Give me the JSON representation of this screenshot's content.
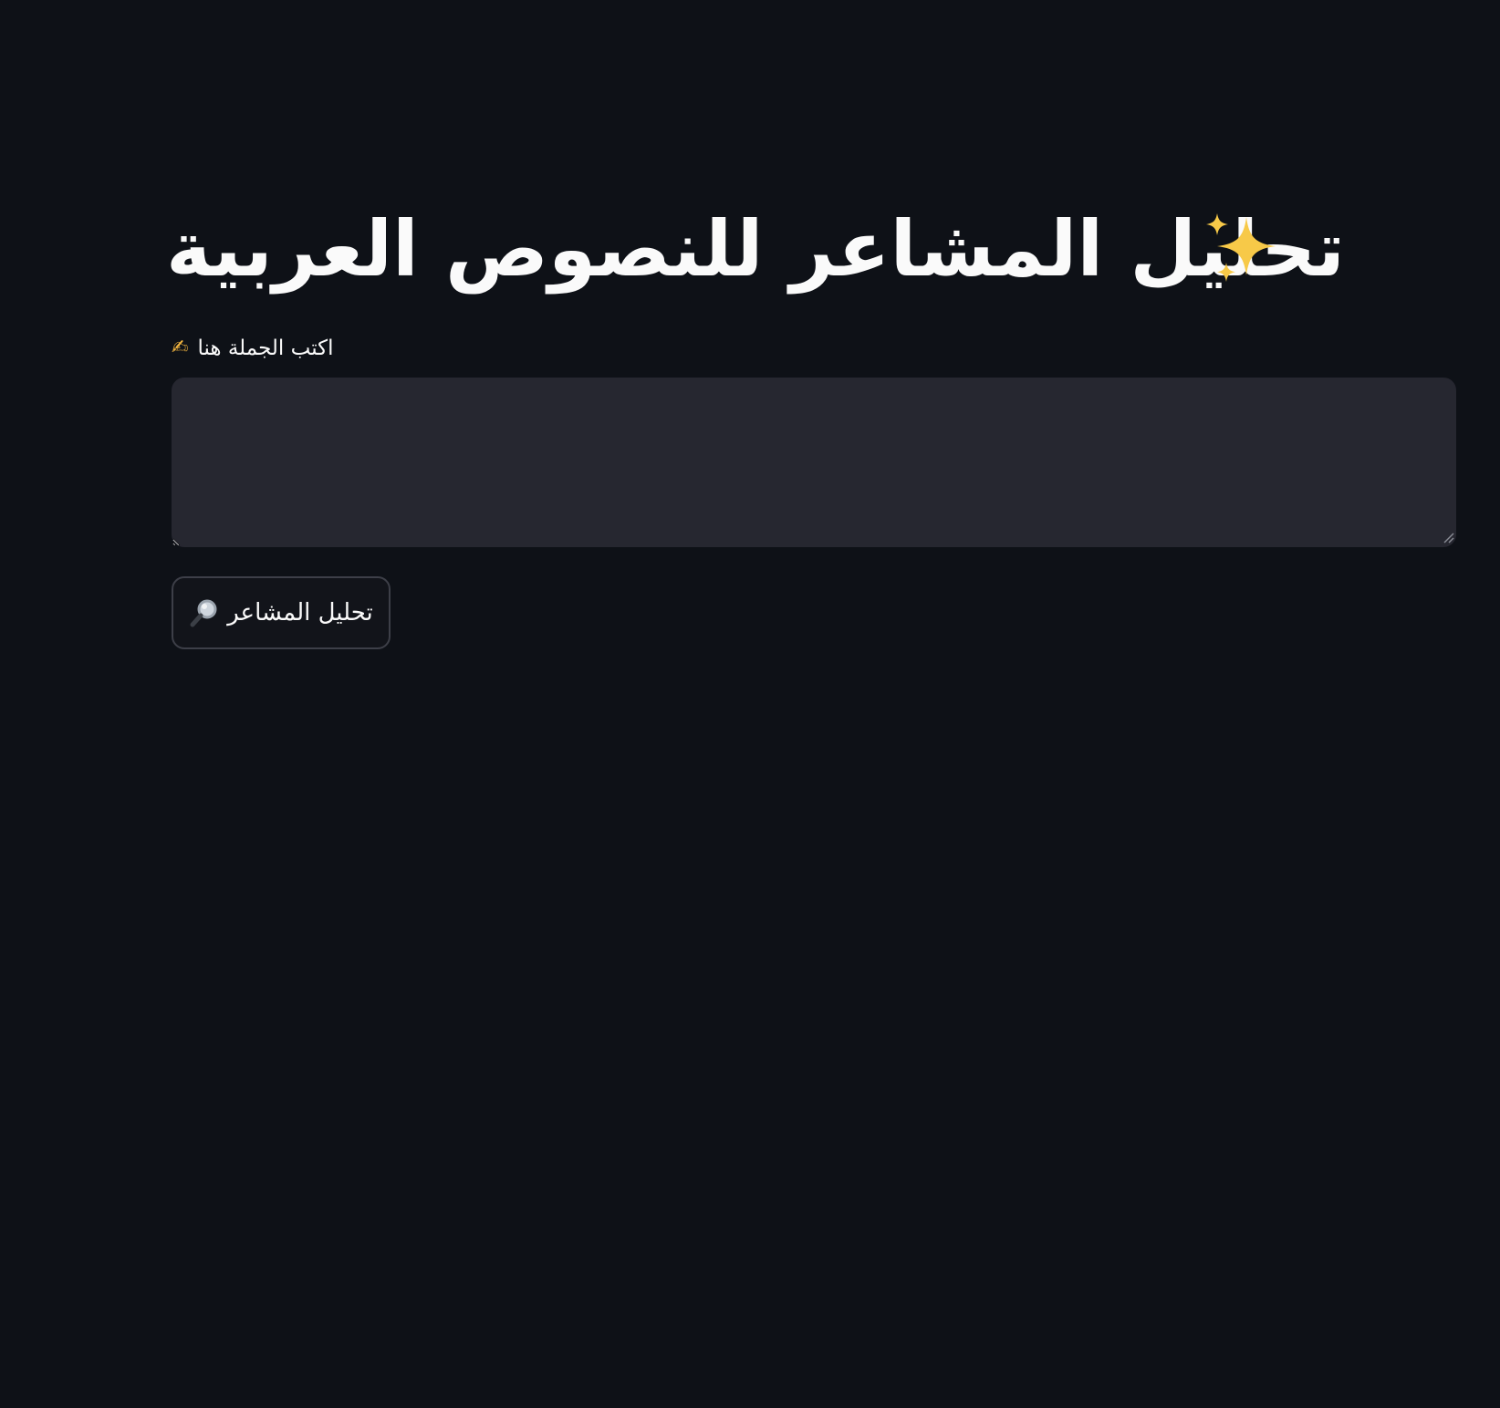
{
  "header": {
    "title": "تحليل المشاعر للنصوص العربية",
    "title_icon": "sparkles-icon"
  },
  "input": {
    "label": "اكتب الجملة هنا",
    "label_icon": "writing-hand-icon",
    "value": "",
    "placeholder": ""
  },
  "actions": {
    "analyze_label": "تحليل المشاعر",
    "analyze_icon": "magnifier-icon"
  },
  "colors": {
    "background": "#0e1117",
    "input_background": "#262730",
    "button_border": "#3d3f48",
    "text": "#fafafa",
    "sparkle": "#f7c948"
  }
}
